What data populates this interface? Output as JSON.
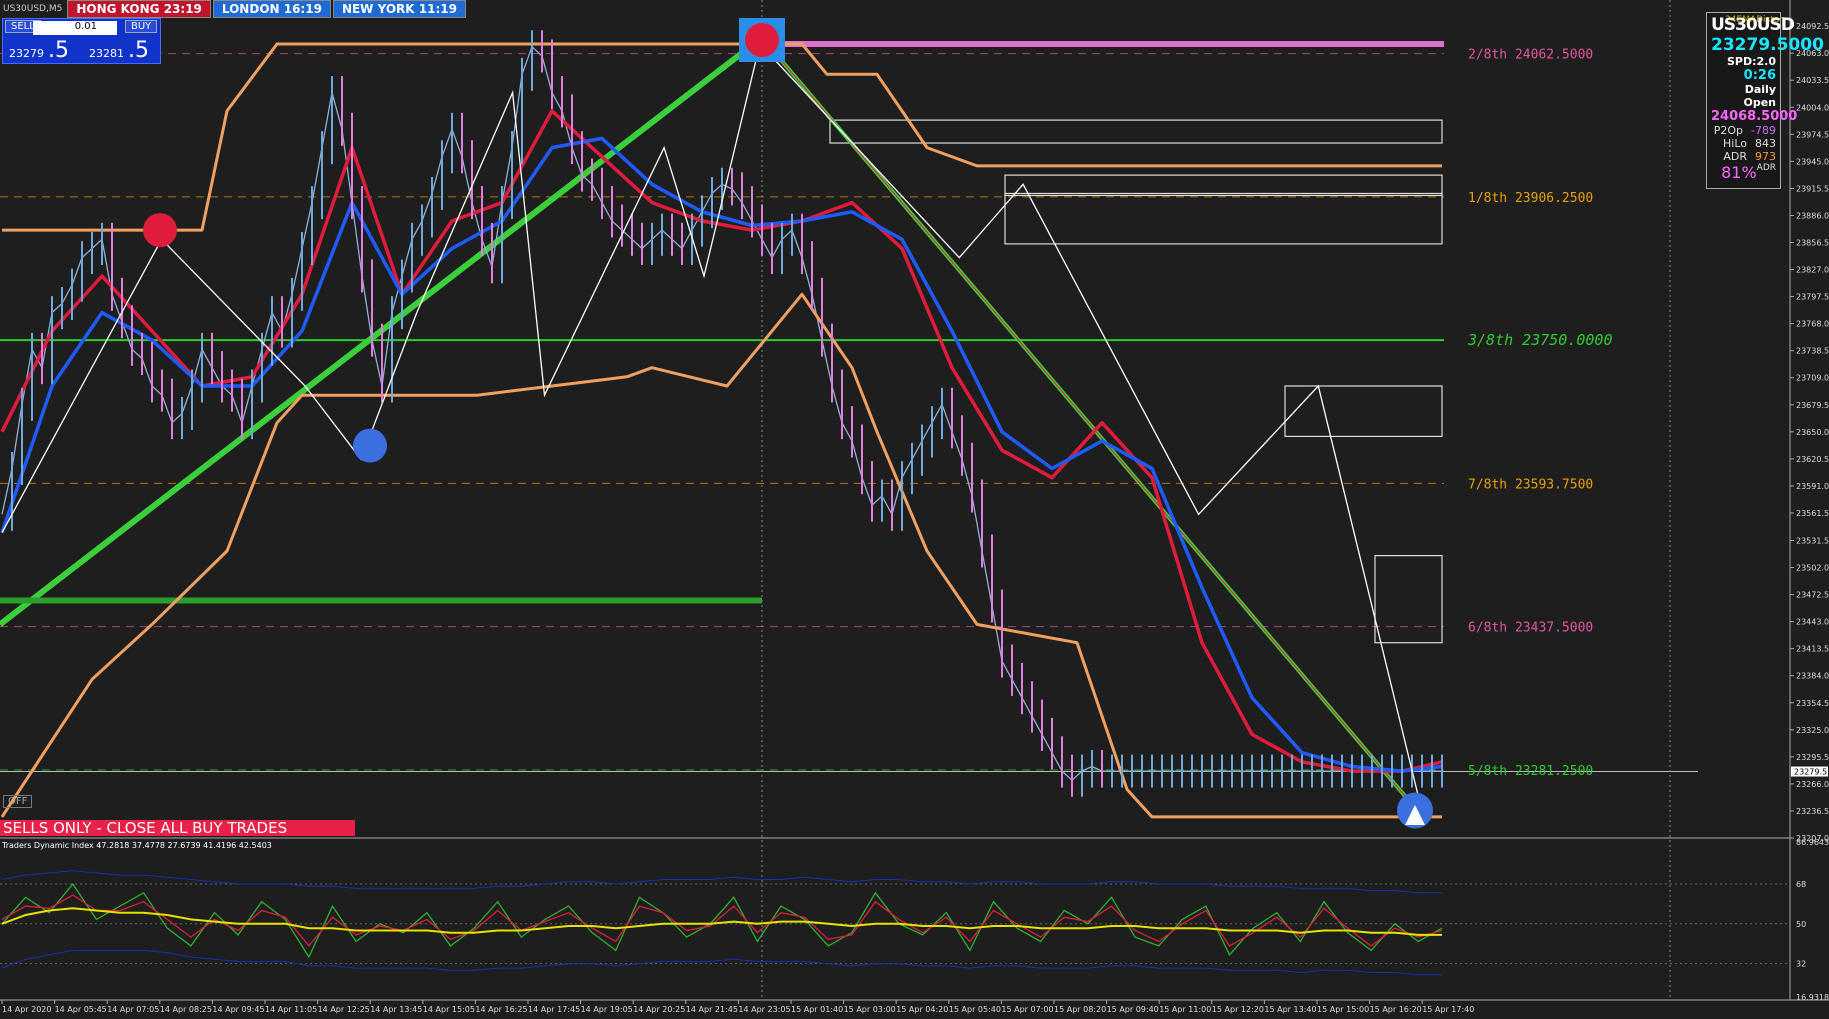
{
  "header": {
    "symbol": "US30USD,M5",
    "sessions": [
      {
        "label": "HONG KONG 23:19",
        "color": "#c0152b"
      },
      {
        "label": "LONDON  16:19",
        "color": "#1f6bd6"
      },
      {
        "label": "NEW YORK  11:19",
        "color": "#1f6bd6"
      }
    ]
  },
  "one_click": {
    "sell_label": "SELL",
    "buy_label": "BUY",
    "lot": "0.01",
    "sell_price_main": "23279",
    "sell_price_big": ".5",
    "buy_price_main": "23281",
    "buy_price_big": ".5"
  },
  "info_panel": {
    "ema_label": "24EMADistan",
    "symbol": "US30USD",
    "bid": "23279.5000",
    "spread": "SPD:2.0",
    "timer": "0:26",
    "daily_open_label": "Daily Open",
    "daily_open": "24068.5000",
    "rows": [
      {
        "k": "P2Op",
        "v": "-789",
        "color": "#c86cff"
      },
      {
        "k": "HiLo",
        "v": "843",
        "color": "#dddddd"
      },
      {
        "k": "ADR",
        "v": "973",
        "color": "#ff9933"
      }
    ],
    "pct": "81%",
    "pct_suffix": "ADR"
  },
  "alert_text": "SELLS ONLY - CLOSE ALL BUY TRADES",
  "off_label": "OFF",
  "chart_data": {
    "type": "line",
    "main": {
      "ylim": [
        23207.0,
        24121.0
      ],
      "price_axis_ticks": [
        24092.5,
        24063.0,
        24033.5,
        24004.0,
        23974.5,
        23945.0,
        23915.5,
        23886.0,
        23856.5,
        23827.0,
        23797.5,
        23768.0,
        23738.5,
        23709.0,
        23679.5,
        23650.0,
        23620.5,
        23591.0,
        23561.5,
        23531.5,
        23502.0,
        23472.5,
        23443.0,
        23413.5,
        23384.0,
        23354.5,
        23325.0,
        23295.5,
        23266.0,
        23236.5,
        23207.0
      ],
      "current_price_label": "23279.5",
      "time_labels": [
        "14 Apr 2020",
        "14 Apr 05:45",
        "14 Apr 07:05",
        "14 Apr 08:25",
        "14 Apr 09:45",
        "14 Apr 11:05",
        "14 Apr 12:25",
        "14 Apr 13:45",
        "14 Apr 15:05",
        "14 Apr 16:25",
        "14 Apr 17:45",
        "14 Apr 19:05",
        "14 Apr 20:25",
        "14 Apr 21:45",
        "14 Apr 23:05",
        "15 Apr 01:40",
        "15 Apr 03:00",
        "15 Apr 04:20",
        "15 Apr 05:40",
        "15 Apr 07:00",
        "15 Apr 08:20",
        "15 Apr 09:40",
        "15 Apr 11:00",
        "15 Apr 12:20",
        "15 Apr 13:40",
        "15 Apr 15:00",
        "15 Apr 16:20",
        "15 Apr 17:40"
      ],
      "murrey_levels": [
        {
          "label": "2/8th   24062.5000",
          "value": 24062.5,
          "color": "#e056a0"
        },
        {
          "label": "1/8th   23906.2500",
          "value": 23906.25,
          "color": "#e8a000"
        },
        {
          "label": "3/8th  23750.0000",
          "value": 23750.0,
          "color": "#2ecc2e"
        },
        {
          "label": "7/8th   23593.7500",
          "value": 23593.75,
          "color": "#e8a000"
        },
        {
          "label": "6/8th   23437.5000",
          "value": 23437.5,
          "color": "#e056a0"
        },
        {
          "label": "5/8th   23281.2500",
          "value": 23281.25,
          "color": "#2ecc2e"
        }
      ],
      "series": [
        {
          "name": "Close",
          "color": "#8fb0d8",
          "x": [
            0,
            2,
            4,
            6,
            8,
            10,
            12,
            14,
            16,
            18,
            20,
            22,
            24,
            26,
            28,
            30,
            32,
            34,
            36,
            38,
            40,
            42,
            44,
            46,
            48,
            50,
            52,
            54,
            56,
            58,
            60,
            62,
            64,
            66,
            68,
            70,
            72,
            74,
            76,
            78,
            80,
            82,
            84,
            86,
            88,
            90,
            92,
            94,
            96,
            98,
            100,
            102,
            104,
            106,
            108,
            110,
            112,
            114,
            116,
            118,
            120,
            122,
            124,
            126,
            128,
            130,
            132,
            134,
            136,
            138,
            140,
            142,
            144,
            146,
            148,
            150,
            152,
            154,
            156,
            158,
            160,
            162,
            164,
            166,
            168,
            170,
            172,
            174,
            176,
            178,
            180,
            182,
            184,
            186,
            188,
            190,
            192,
            194,
            196,
            198,
            200,
            202,
            204,
            206,
            208,
            210,
            212,
            214,
            216,
            218,
            220,
            222,
            224,
            226,
            228,
            230,
            232,
            234,
            236,
            238,
            240,
            242,
            244,
            246,
            248,
            250,
            252,
            254,
            256,
            258,
            260,
            262,
            264,
            266,
            268,
            270,
            272,
            274,
            276,
            278,
            280,
            282,
            284,
            286,
            288
          ],
          "y": [
            23560,
            23610,
            23680,
            23740,
            23720,
            23780,
            23790,
            23810,
            23840,
            23850,
            23860,
            23800,
            23770,
            23740,
            23730,
            23700,
            23690,
            23660,
            23670,
            23700,
            23740,
            23720,
            23700,
            23690,
            23660,
            23700,
            23740,
            23780,
            23760,
            23800,
            23850,
            23900,
            23960,
            24020,
            23980,
            23900,
            23820,
            23750,
            23700,
            23780,
            23820,
            23860,
            23880,
            23910,
            23950,
            23980,
            23950,
            23900,
            23860,
            23830,
            23900,
            23960,
            24040,
            24070,
            24060,
            24020,
            24000,
            23960,
            23930,
            23920,
            23900,
            23880,
            23870,
            23860,
            23850,
            23860,
            23870,
            23860,
            23850,
            23870,
            23890,
            23910,
            23920,
            23915,
            23900,
            23880,
            23860,
            23840,
            23860,
            23870,
            23840,
            23800,
            23750,
            23700,
            23660,
            23640,
            23600,
            23570,
            23580,
            23560,
            23600,
            23620,
            23640,
            23660,
            23680,
            23650,
            23620,
            23580,
            23520,
            23460,
            23400,
            23380,
            23360,
            23340,
            23320,
            23300,
            23280,
            23270,
            23280,
            23285,
            23280,
            23280,
            23280,
            23280,
            23280,
            23280,
            23280,
            23280,
            23280,
            23280,
            23280,
            23280,
            23280,
            23280,
            23280,
            23280,
            23280,
            23280,
            23280,
            23280,
            23280,
            23280,
            23280,
            23280,
            23280,
            23280,
            23280,
            23280,
            23280,
            23280,
            23280,
            23280,
            23280,
            23280,
            23280
          ]
        },
        {
          "name": "EMA fast",
          "color": "#e01c3c",
          "x": [
            0,
            10,
            20,
            30,
            40,
            50,
            60,
            70,
            80,
            90,
            100,
            110,
            120,
            130,
            140,
            150,
            160,
            170,
            180,
            190,
            200,
            210,
            220,
            230,
            240,
            250,
            260,
            270,
            280,
            288
          ],
          "y": [
            23650,
            23760,
            23820,
            23760,
            23700,
            23710,
            23800,
            23960,
            23800,
            23880,
            23900,
            24000,
            23950,
            23900,
            23880,
            23870,
            23880,
            23900,
            23850,
            23720,
            23630,
            23600,
            23660,
            23600,
            23420,
            23320,
            23290,
            23280,
            23280,
            23290
          ]
        },
        {
          "name": "EMA slow",
          "color": "#1f5bff",
          "x": [
            0,
            10,
            20,
            30,
            40,
            50,
            60,
            70,
            80,
            90,
            100,
            110,
            120,
            130,
            140,
            150,
            160,
            170,
            180,
            190,
            200,
            210,
            220,
            230,
            240,
            250,
            260,
            270,
            280,
            288
          ],
          "y": [
            23540,
            23700,
            23780,
            23750,
            23700,
            23700,
            23760,
            23900,
            23800,
            23850,
            23880,
            23960,
            23970,
            23920,
            23890,
            23875,
            23880,
            23890,
            23860,
            23760,
            23650,
            23610,
            23640,
            23610,
            23480,
            23360,
            23300,
            23285,
            23280,
            23285
          ]
        },
        {
          "name": "Donchian upper",
          "color": "#f0a060",
          "x": [
            0,
            40,
            45,
            55,
            95,
            100,
            125,
            145,
            150,
            160,
            165,
            175,
            180,
            185,
            195,
            200,
            210,
            225,
            260,
            288
          ],
          "y": [
            23870,
            23870,
            24000,
            24073,
            24073,
            24073,
            24073,
            24073,
            24073,
            24073,
            24040,
            24040,
            24000,
            23960,
            23940,
            23940,
            23940,
            23940,
            23940,
            23940
          ]
        },
        {
          "name": "Donchian lower",
          "color": "#f0a060",
          "x": [
            0,
            12,
            18,
            30,
            45,
            55,
            60,
            75,
            95,
            110,
            125,
            130,
            145,
            160,
            170,
            175,
            185,
            195,
            215,
            225,
            230,
            288
          ],
          "y": [
            23230,
            23330,
            23380,
            23440,
            23520,
            23660,
            23690,
            23690,
            23690,
            23700,
            23710,
            23720,
            23700,
            23800,
            23720,
            23650,
            23520,
            23440,
            23420,
            23260,
            23230,
            23230
          ]
        }
      ]
    },
    "indicator": {
      "title": "Traders Dynamic Index 47.2818 37.4778 27.6739 41.4196 42.5403",
      "ylim": [
        16.9318,
        86.9643
      ],
      "ticks": [
        86.9643,
        68,
        50,
        32,
        16.9318
      ],
      "series": [
        {
          "name": "RSI",
          "color": "#2fb02f",
          "values": [
            50,
            62,
            55,
            68,
            52,
            58,
            64,
            48,
            40,
            55,
            45,
            60,
            52,
            35,
            58,
            42,
            50,
            46,
            55,
            40,
            48,
            60,
            44,
            52,
            58,
            46,
            38,
            62,
            55,
            44,
            50,
            62,
            42,
            58,
            52,
            40,
            46,
            64,
            50,
            45,
            55,
            38,
            60,
            48,
            42,
            56,
            50,
            62,
            44,
            40,
            52,
            58,
            36,
            48,
            55,
            42,
            60,
            46,
            38,
            50,
            42,
            48
          ]
        },
        {
          "name": "Signal",
          "color": "#e01c3c",
          "values": [
            52,
            58,
            57,
            63,
            56,
            56,
            60,
            52,
            44,
            52,
            47,
            56,
            53,
            40,
            53,
            45,
            49,
            47,
            52,
            43,
            47,
            56,
            47,
            51,
            55,
            48,
            42,
            58,
            55,
            47,
            49,
            58,
            46,
            55,
            53,
            43,
            45,
            60,
            52,
            46,
            53,
            42,
            56,
            50,
            44,
            53,
            51,
            58,
            47,
            42,
            50,
            56,
            40,
            46,
            53,
            44,
            57,
            48,
            40,
            48,
            44,
            47
          ]
        },
        {
          "name": "Market Base",
          "color": "#e8e000",
          "values": [
            50,
            54,
            56,
            57,
            56,
            55,
            55,
            54,
            52,
            51,
            50,
            50,
            50,
            48,
            48,
            47,
            47,
            47,
            47,
            46,
            46,
            47,
            47,
            48,
            49,
            49,
            48,
            49,
            50,
            50,
            50,
            51,
            50,
            51,
            51,
            50,
            49,
            50,
            50,
            49,
            49,
            48,
            49,
            49,
            48,
            48,
            48,
            49,
            49,
            48,
            48,
            48,
            47,
            47,
            47,
            46,
            47,
            47,
            46,
            46,
            45,
            45
          ]
        },
        {
          "name": "Upper band",
          "color": "#1a2fb0",
          "values": [
            70,
            72,
            73,
            74,
            73,
            72,
            72,
            71,
            70,
            69,
            68,
            68,
            68,
            67,
            67,
            66,
            66,
            66,
            66,
            66,
            66,
            67,
            67,
            68,
            69,
            69,
            68,
            69,
            70,
            70,
            70,
            71,
            70,
            70,
            71,
            70,
            69,
            70,
            70,
            69,
            69,
            68,
            69,
            69,
            68,
            68,
            68,
            69,
            69,
            68,
            68,
            68,
            67,
            67,
            67,
            66,
            66,
            66,
            65,
            65,
            64,
            64
          ]
        },
        {
          "name": "Lower band",
          "color": "#1a2fb0",
          "values": [
            30,
            34,
            36,
            38,
            38,
            38,
            38,
            37,
            35,
            34,
            33,
            33,
            33,
            31,
            31,
            30,
            30,
            30,
            30,
            29,
            29,
            30,
            30,
            31,
            32,
            32,
            31,
            32,
            33,
            33,
            33,
            34,
            33,
            33,
            33,
            32,
            31,
            32,
            32,
            31,
            31,
            30,
            31,
            31,
            30,
            30,
            30,
            31,
            31,
            30,
            30,
            30,
            29,
            29,
            29,
            28,
            29,
            29,
            28,
            28,
            27,
            27
          ]
        }
      ]
    }
  }
}
